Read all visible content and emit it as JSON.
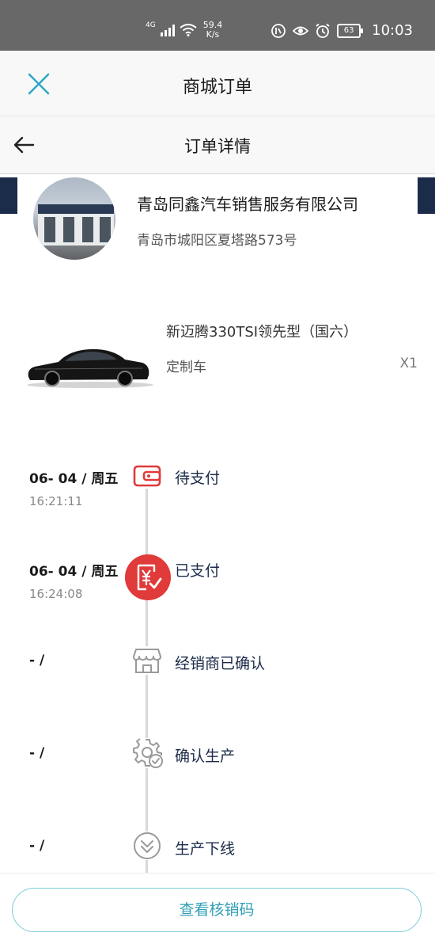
{
  "status_bar": {
    "network": "4G",
    "speed_value": "59.4",
    "speed_unit": "K/s",
    "battery": "63",
    "time": "10:03"
  },
  "window": {
    "title": "商城订单"
  },
  "page": {
    "title": "订单详情"
  },
  "dealer": {
    "name": "青岛同鑫汽车销售服务有限公司",
    "address": "青岛市城阳区夏塔路573号"
  },
  "product": {
    "name": "新迈腾330TSI领先型（国六）",
    "type": "定制车",
    "quantity": "X1"
  },
  "timeline": [
    {
      "date": "06- 04 / 周五",
      "time": "16:21:11",
      "label": "待支付",
      "icon": "wallet-icon",
      "active": true
    },
    {
      "date": "06- 04 / 周五",
      "time": "16:24:08",
      "label": "已支付",
      "icon": "yuan-check-icon",
      "active": true
    },
    {
      "date": "- /",
      "time": "",
      "label": "经销商已确认",
      "icon": "store-icon",
      "active": false
    },
    {
      "date": "- /",
      "time": "",
      "label": "确认生产",
      "icon": "gear-check-icon",
      "active": false
    },
    {
      "date": "- /",
      "time": "",
      "label": "生产下线",
      "icon": "download-circle-icon",
      "active": false
    }
  ],
  "footer": {
    "button_label": "查看核销码"
  },
  "colors": {
    "accent": "#2f9fb5",
    "active_red": "#e03a3a",
    "navy": "#1b2b4a",
    "status_bar": "#686868"
  }
}
